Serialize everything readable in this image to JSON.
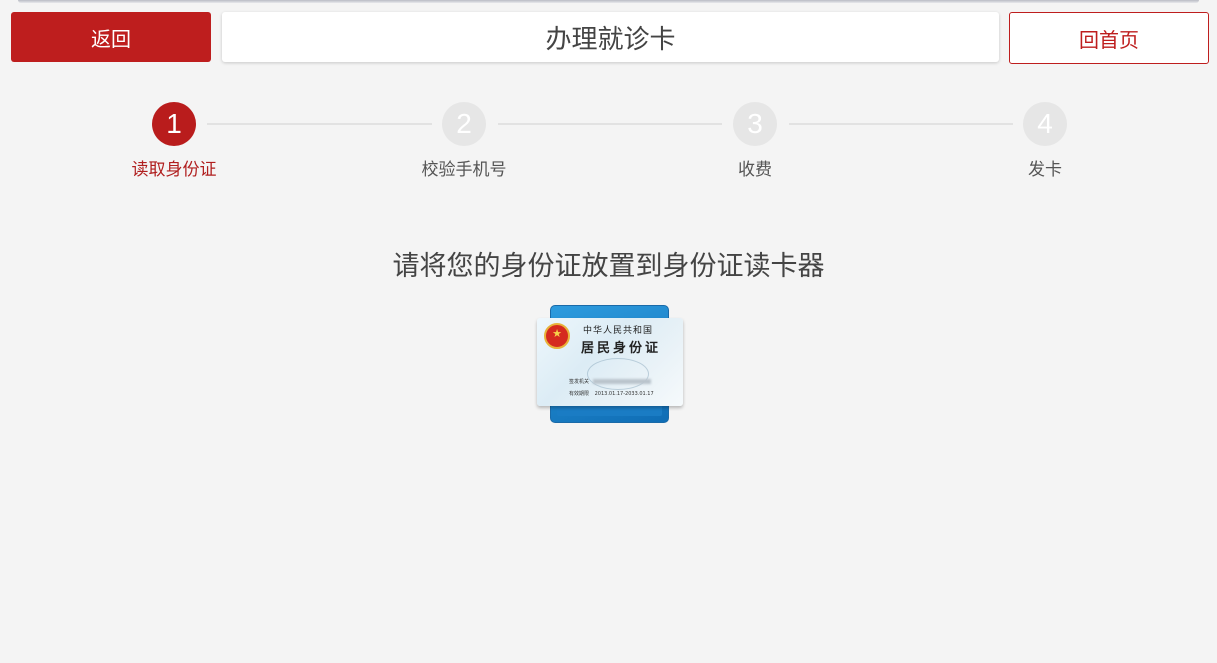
{
  "header": {
    "back_label": "返回",
    "title": "办理就诊卡",
    "home_label": "回首页"
  },
  "steps": [
    {
      "number": "1",
      "label": "读取身份证",
      "active": true
    },
    {
      "number": "2",
      "label": "校验手机号",
      "active": false
    },
    {
      "number": "3",
      "label": "收费",
      "active": false
    },
    {
      "number": "4",
      "label": "发卡",
      "active": false
    }
  ],
  "main": {
    "instruction": "请将您的身份证放置到身份证读卡器"
  },
  "id_card": {
    "line1": "中华人民共和国",
    "line2": "居民身份证",
    "issuer_label": "签发机关",
    "validity_label": "有效期限",
    "validity_value": "2013.01.17-2033.01.17"
  },
  "colors": {
    "accent": "#be1e1e",
    "inactive_step": "#e6e6e6",
    "background": "#f4f4f4"
  }
}
